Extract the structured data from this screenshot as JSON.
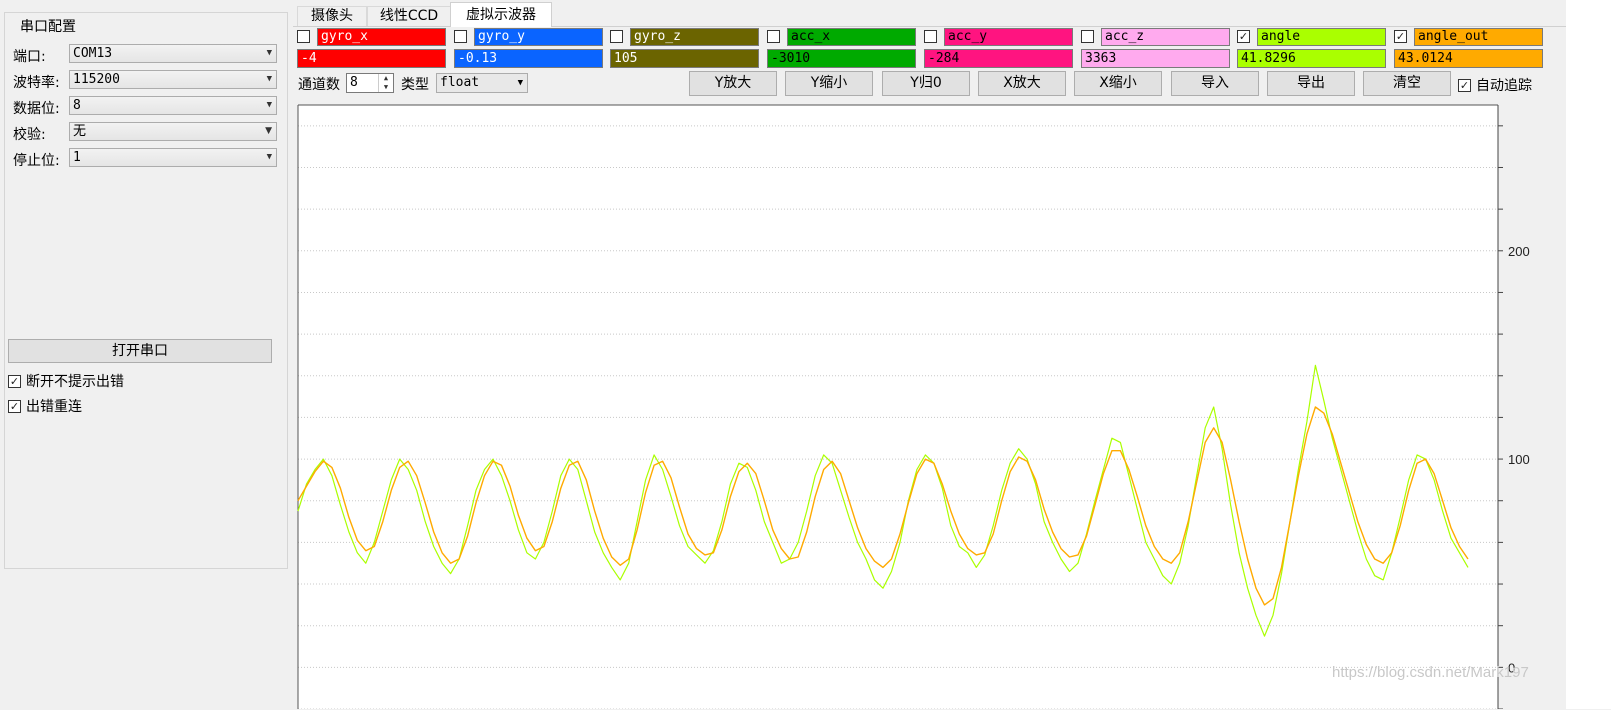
{
  "serial": {
    "group_title": "串口配置",
    "fields": [
      {
        "label": "端口:",
        "value": "COM13"
      },
      {
        "label": "波特率:",
        "value": "115200"
      },
      {
        "label": "数据位:",
        "value": "8"
      },
      {
        "label": "校验:",
        "value": "无"
      },
      {
        "label": "停止位:",
        "value": "1"
      }
    ],
    "open_button": "打开串口",
    "options": [
      {
        "label": "断开不提示出错",
        "checked": true
      },
      {
        "label": "出错重连",
        "checked": true
      }
    ]
  },
  "tabs": [
    {
      "label": "摄像头",
      "active": false
    },
    {
      "label": "线性CCD",
      "active": false
    },
    {
      "label": "虚拟示波器",
      "active": true
    }
  ],
  "channels": [
    {
      "name": "gyro_x",
      "value": "-4",
      "checked": false,
      "color": "#ff0000",
      "text_color": "#ffffff"
    },
    {
      "name": "gyro_y",
      "value": "-0.13",
      "checked": false,
      "color": "#0a64ff",
      "text_color": "#ffffff"
    },
    {
      "name": "gyro_z",
      "value": "105",
      "checked": false,
      "color": "#6b6400",
      "text_color": "#ffffff"
    },
    {
      "name": "acc_x",
      "value": "-3010",
      "checked": false,
      "color": "#00aa00",
      "text_color": "#000000"
    },
    {
      "name": "acc_y",
      "value": "-284",
      "checked": false,
      "color": "#ff1480",
      "text_color": "#000000"
    },
    {
      "name": "acc_z",
      "value": "3363",
      "checked": false,
      "color": "#ffaaee",
      "text_color": "#000000"
    },
    {
      "name": "angle",
      "value": "41.8296",
      "checked": true,
      "color": "#aaff00",
      "text_color": "#000000"
    },
    {
      "name": "angle_out",
      "value": "43.0124",
      "checked": true,
      "color": "#ffaa00",
      "text_color": "#000000"
    }
  ],
  "toolbar": {
    "channel_count_label": "通道数",
    "channel_count": "8",
    "type_label": "类型",
    "type_value": "float",
    "buttons": [
      "Y放大",
      "Y缩小",
      "Y归0",
      "X放大",
      "X缩小",
      "导入",
      "导出",
      "清空"
    ],
    "auto_track_label": "自动追踪",
    "auto_track_checked": true
  },
  "chart_data": {
    "type": "line",
    "yticks": [
      0,
      100,
      200
    ],
    "ylim": [
      -20,
      270
    ],
    "grid": true,
    "series": [
      {
        "name": "angle",
        "color": "#aaff00",
        "values": [
          75,
          88,
          95,
          100,
          92,
          78,
          65,
          55,
          50,
          60,
          75,
          90,
          100,
          95,
          85,
          70,
          58,
          50,
          45,
          52,
          68,
          85,
          95,
          100,
          92,
          80,
          66,
          55,
          52,
          60,
          75,
          92,
          100,
          95,
          80,
          65,
          55,
          48,
          42,
          50,
          70,
          90,
          102,
          95,
          82,
          68,
          58,
          54,
          50,
          56,
          70,
          88,
          98,
          96,
          85,
          70,
          60,
          50,
          52,
          60,
          75,
          92,
          102,
          98,
          85,
          72,
          60,
          52,
          42,
          38,
          46,
          60,
          80,
          95,
          102,
          98,
          86,
          68,
          58,
          55,
          48,
          54,
          68,
          85,
          98,
          105,
          100,
          88,
          70,
          60,
          52,
          46,
          50,
          64,
          80,
          95,
          110,
          108,
          92,
          76,
          60,
          52,
          44,
          40,
          50,
          68,
          92,
          115,
          125,
          105,
          78,
          55,
          38,
          25,
          15,
          25,
          45,
          70,
          95,
          118,
          145,
          128,
          110,
          95,
          80,
          65,
          52,
          44,
          42,
          55,
          72,
          90,
          102,
          100,
          90,
          75,
          62,
          55,
          48
        ]
      },
      {
        "name": "angle_out",
        "color": "#ffaa00",
        "values": [
          80,
          87,
          94,
          99,
          96,
          86,
          72,
          61,
          56,
          58,
          70,
          85,
          96,
          99,
          92,
          79,
          65,
          55,
          50,
          52,
          63,
          79,
          92,
          99,
          97,
          87,
          73,
          62,
          56,
          58,
          70,
          86,
          97,
          99,
          90,
          75,
          62,
          53,
          49,
          52,
          66,
          84,
          97,
          99,
          91,
          77,
          64,
          57,
          54,
          55,
          66,
          82,
          94,
          98,
          93,
          80,
          66,
          57,
          52,
          53,
          65,
          82,
          95,
          99,
          93,
          80,
          67,
          57,
          51,
          48,
          52,
          64,
          79,
          93,
          100,
          98,
          88,
          75,
          64,
          57,
          54,
          55,
          64,
          80,
          94,
          101,
          99,
          90,
          76,
          65,
          57,
          53,
          54,
          63,
          78,
          93,
          104,
          104,
          95,
          82,
          68,
          58,
          52,
          50,
          55,
          70,
          89,
          108,
          115,
          108,
          90,
          70,
          52,
          38,
          30,
          33,
          48,
          70,
          92,
          112,
          125,
          122,
          112,
          98,
          84,
          70,
          59,
          52,
          50,
          55,
          68,
          85,
          98,
          100,
          93,
          80,
          67,
          58,
          52
        ]
      }
    ]
  },
  "watermark": "https://blog.csdn.net/Mark197"
}
